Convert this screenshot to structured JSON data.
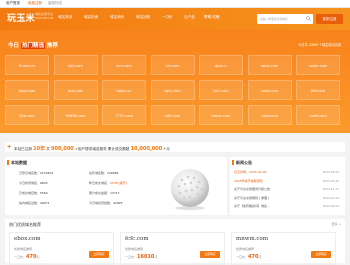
{
  "topbar": {
    "login": "用户登录",
    "register": "免费注册",
    "phone": "客服热线"
  },
  "header": {
    "logo": "玩玉米",
    "slogan": "域名交易平台",
    "slogan_sub": "WANYUMI.COM",
    "nav": [
      "域名首页",
      "域名拍卖",
      "域名询价",
      "域名回收",
      "一口价",
      "云产品",
      "帮助/攻略"
    ],
    "search_placeholder": "请输入你要搜索的域名",
    "login_button": "登录/注册"
  },
  "hero": {
    "title_prefix": "今日",
    "title_highlight": "热门精选",
    "title_suffix": "推荐",
    "right_prefix": "今日共",
    "right_count": "2299",
    "right_suffix": "个域名成功交易",
    "domains": [
      "ft.com.cn",
      "lyfy.com",
      "yiro.com",
      "lvd.com",
      "qlsd.cc",
      "hpkx.com",
      "svgm.com",
      "gbpj.com",
      "qcd.com",
      "taijun.cc",
      "qzhj.com",
      "fpkl.com",
      "zrwd.com",
      "jklf.com",
      "fj2e.com",
      "99898.com",
      "7731.com",
      "hdfj.com",
      "bmpe.com",
      "rwvy.com",
      "meik.com"
    ]
  },
  "stats": {
    "text1": "本站已注册",
    "years": "10年",
    "text2": "共",
    "users": "900,000",
    "text3": "+用户提供域名服务  累计成交额超",
    "amount": "10,000,000",
    "text4": "+元"
  },
  "overview": {
    "title": "本站数据",
    "rows": [
      {
        "label": "已登记域名数：",
        "value": "2154402",
        "label2": "在售域名数：",
        "value2": "126669"
      },
      {
        "label": "今日新增域名：",
        "value": "6825",
        "label2": "昨日成交域名：",
        "value2": "2158 [展开]"
      },
      {
        "label": "已成交域名数：",
        "value": "5564",
        "label2": "累计成交金额：",
        "value2": "13717"
      },
      {
        "label": "站内域名总数：",
        "value": "49671",
        "label2": "今日域名增加数：",
        "value2": "42825"
      }
    ]
  },
  "announcements": {
    "title": "新闻公告",
    "more": "更多 >",
    "items": [
      {
        "text": "玩玉米网，2025-02-08",
        "date": "2025-02-08",
        "highlight": true
      },
      {
        "text": "2025年春节放假通知",
        "date": "2025-01-20",
        "highlight": true
      },
      {
        "text": "关于平台交易服务升级公告",
        "date": "2024-12-11",
        "highlight": false
      },
      {
        "text": "关于平台交易规则 [ 重要 ]",
        "date": "2024-10-18",
        "highlight": false
      },
      {
        "text": "关于【含有敏感词】域名...",
        "date": "2024-09-02",
        "highlight": false
      }
    ]
  },
  "recommend": {
    "title": "热门优质域名推荐",
    "more": "更多 >",
    "cards": [
      {
        "domain": "ebox.com",
        "label": "优质域名推荐",
        "price_prefix": "一口价：",
        "price": "470",
        "unit": "元",
        "button": "立即购买"
      },
      {
        "domain": "fcfc.com",
        "label": "优质域名推荐",
        "price_prefix": "一口价：",
        "price": "16010",
        "unit": "元",
        "button": "立即购买"
      },
      {
        "domain": "mnwm.com",
        "label": "优质域名推荐",
        "price_prefix": "一口价：",
        "price": "470",
        "unit": "元",
        "button": "立即购买"
      }
    ]
  },
  "colors": {
    "brand": "#f37a10",
    "accent": "#e85f0a"
  }
}
